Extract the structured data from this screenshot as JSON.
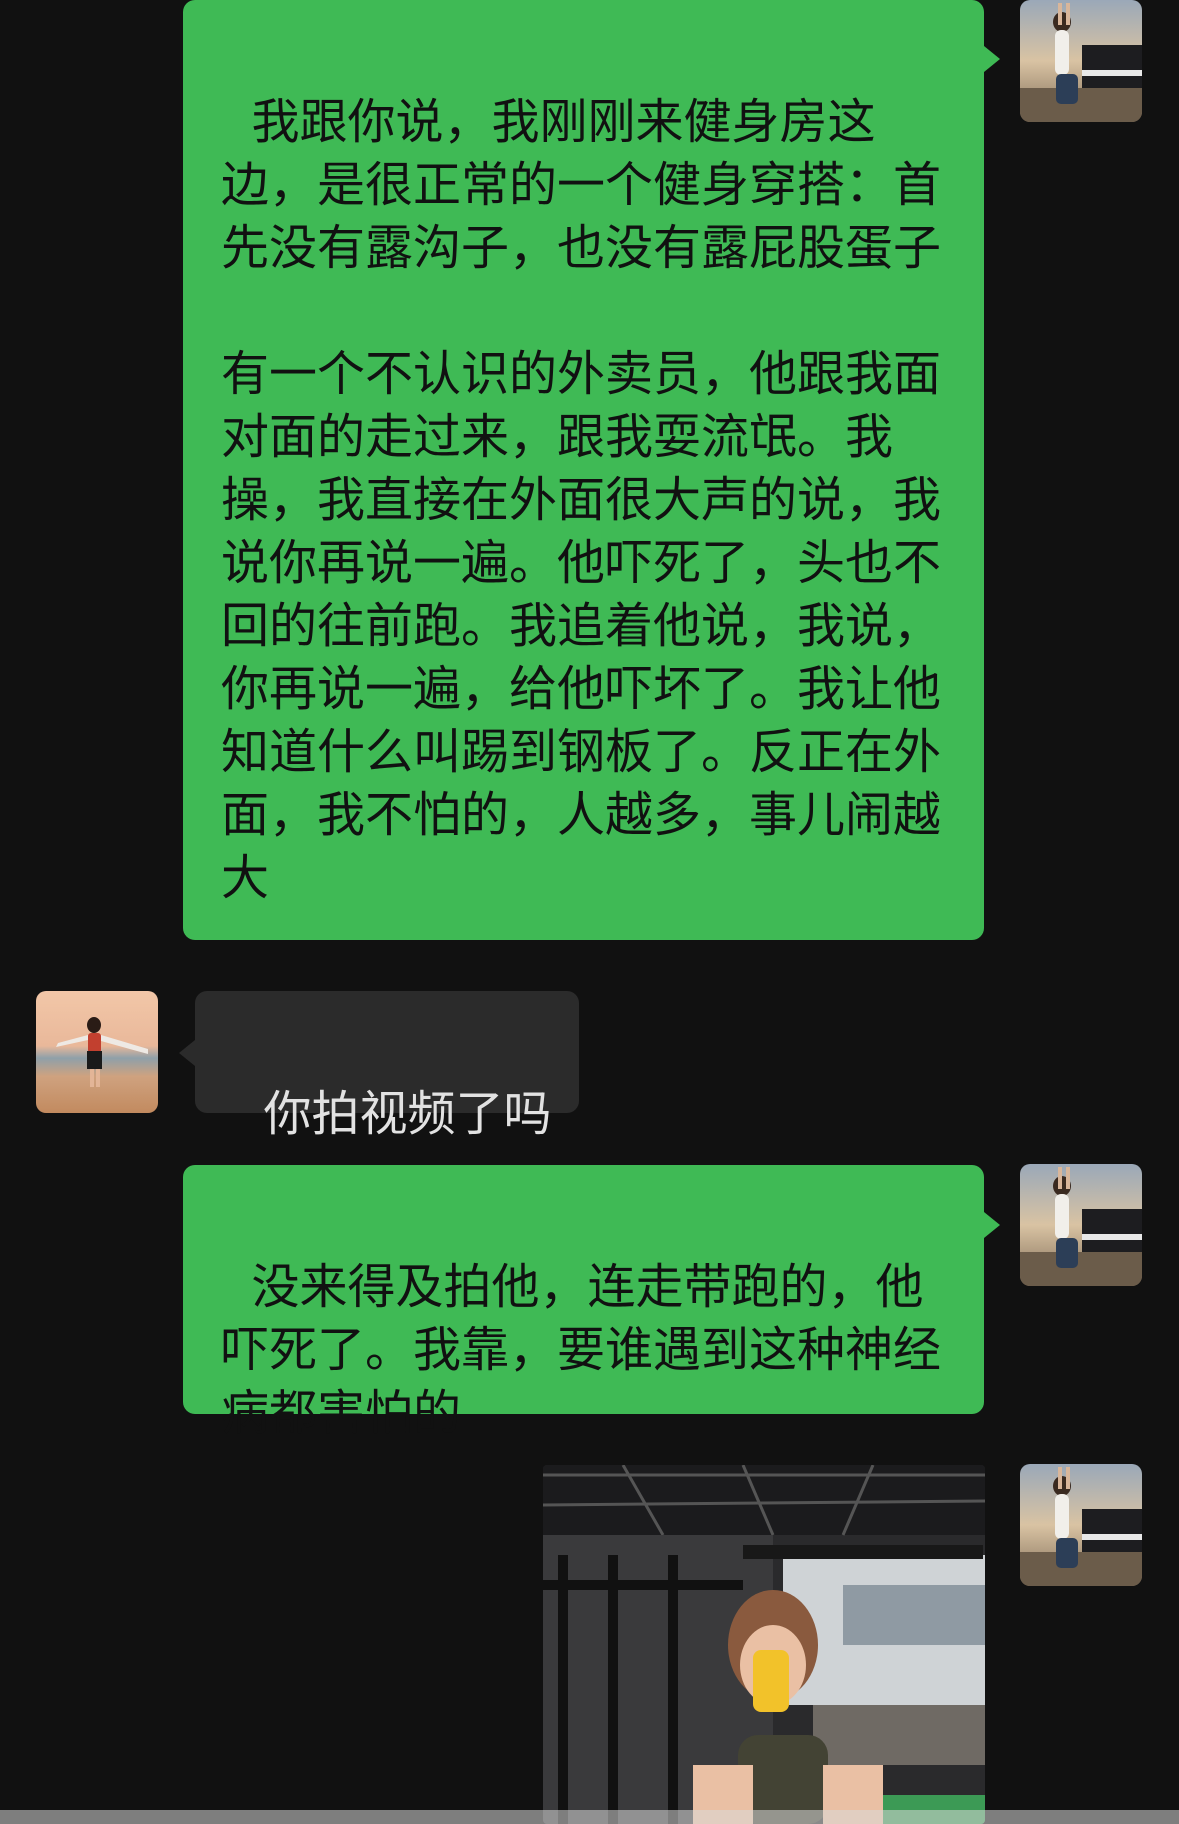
{
  "messages": [
    {
      "id": "m1",
      "sender": "me",
      "avatar": "self-avatar-piano",
      "text": "我跟你说，我刚刚来健身房这边，是很正常的一个健身穿搭：首先没有露沟子，也没有露屁股蛋子\n\n有一个不认识的外卖员，他跟我面对面的走过来，跟我耍流氓。我操，我直接在外面很大声的说，我说你再说一遍。他吓死了，头也不回的往前跑。我追着他说，我说，你再说一遍，给他吓坏了。我让他知道什么叫踢到钢板了。反正在外面，我不怕的，人越多，事儿闹越大"
    },
    {
      "id": "m2",
      "sender": "other",
      "avatar": "friend-avatar-beach",
      "text": "你拍视频了吗"
    },
    {
      "id": "m3",
      "sender": "me",
      "avatar": "self-avatar-piano",
      "text": "没来得及拍他，连走带跑的，他吓死了。我靠，要谁遇到这种神经病都害怕的"
    },
    {
      "id": "m4",
      "sender": "me",
      "avatar": "self-avatar-piano",
      "image": "gym-mirror-selfie-photo"
    }
  ],
  "colors": {
    "background": "#111111",
    "outgoing_bubble": "#3fba55",
    "incoming_bubble": "#2b2b2b",
    "incoming_text": "#e2e2e2",
    "outgoing_text": "#111111"
  }
}
